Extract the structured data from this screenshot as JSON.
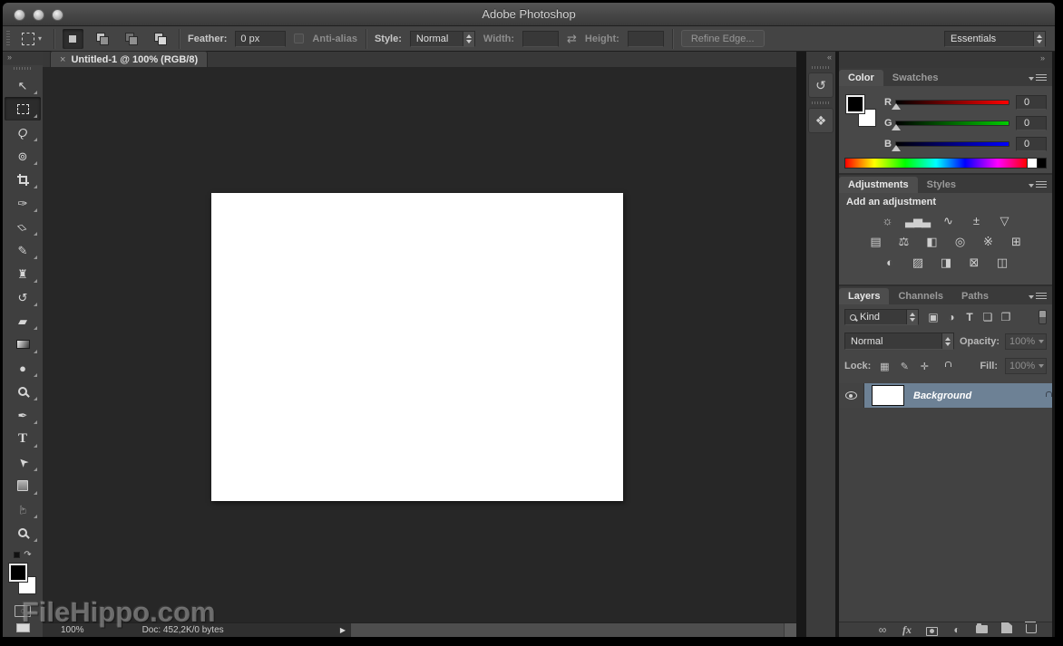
{
  "window": {
    "title": "Adobe Photoshop"
  },
  "options_bar": {
    "feather_label": "Feather:",
    "feather_value": "0 px",
    "antialias_label": "Anti-alias",
    "style_label": "Style:",
    "style_value": "Normal",
    "width_label": "Width:",
    "width_value": "",
    "height_label": "Height:",
    "height_value": "",
    "refine_edge_label": "Refine Edge...",
    "workspace_value": "Essentials"
  },
  "chrome": {
    "toolbar_collapse": "»",
    "dock_collapse": "«",
    "panels_collapse": "»",
    "swap_dims_icon": "⇄"
  },
  "document": {
    "tab_title": "Untitled-1 @ 100% (RGB/8)",
    "close_label": "×",
    "status": {
      "zoom": "100%",
      "doc_size": "Doc: 452,2K/0 bytes",
      "play_icon": "▶"
    }
  },
  "toolbar": {
    "tools": [
      {
        "name": "move-tool",
        "glyph": "↖"
      },
      {
        "name": "rectangular-marquee-tool",
        "glyph": "",
        "cls": "selected tool-marquee"
      },
      {
        "name": "lasso-tool",
        "glyph": "Q",
        "cls": "ital r15"
      },
      {
        "name": "quick-selection-tool",
        "glyph": "⊚"
      },
      {
        "name": "crop-tool",
        "glyph": "",
        "cls": "tool-crop"
      },
      {
        "name": "eyedropper-tool",
        "glyph": "✑"
      },
      {
        "name": "spot-healing-brush-tool",
        "glyph": "▱",
        "cls": "r45"
      },
      {
        "name": "brush-tool",
        "glyph": "✎"
      },
      {
        "name": "clone-stamp-tool",
        "glyph": "♜"
      },
      {
        "name": "history-brush-tool",
        "glyph": "↺"
      },
      {
        "name": "eraser-tool",
        "glyph": "▰"
      },
      {
        "name": "gradient-tool",
        "glyph": "",
        "cls": "tool-gradient"
      },
      {
        "name": "blur-tool",
        "glyph": "●"
      },
      {
        "name": "dodge-tool",
        "glyph": "",
        "cls": "tool-mag"
      },
      {
        "name": "pen-tool",
        "glyph": "✒"
      },
      {
        "name": "type-tool",
        "glyph": "T",
        "cls": "serif"
      },
      {
        "name": "path-selection-tool",
        "glyph": "➤",
        "cls": "rm135"
      },
      {
        "name": "rectangle-tool",
        "glyph": "",
        "cls": "tool-shape"
      },
      {
        "name": "hand-tool",
        "glyph": "☞",
        "cls": "rm90"
      },
      {
        "name": "zoom-tool",
        "glyph": "",
        "cls": "tool-mag"
      }
    ],
    "swap_colors_icon": "↷",
    "quick_mask_icon": "◌"
  },
  "panels": {
    "dock": {
      "icons": [
        {
          "name": "history-panel-icon",
          "glyph": "↺"
        },
        {
          "name": "properties-panel-icon",
          "glyph": "❖"
        }
      ]
    },
    "color": {
      "tabs": [
        "Color",
        "Swatches"
      ],
      "channels": [
        {
          "label": "R",
          "value": "0",
          "color": "#ff0000"
        },
        {
          "label": "G",
          "value": "0",
          "color": "#00cc00"
        },
        {
          "label": "B",
          "value": "0",
          "color": "#0000ff"
        }
      ]
    },
    "adjustments": {
      "tabs": [
        "Adjustments",
        "Styles"
      ],
      "hint": "Add an adjustment",
      "row1": [
        {
          "name": "brightness-contrast-icon",
          "glyph": "☼"
        },
        {
          "name": "levels-icon",
          "glyph": "▃▅▃"
        },
        {
          "name": "curves-icon",
          "glyph": "∿"
        },
        {
          "name": "exposure-icon",
          "glyph": "±"
        },
        {
          "name": "vibrance-icon",
          "glyph": "▽"
        }
      ],
      "row2": [
        {
          "name": "hue-saturation-icon",
          "glyph": "▤"
        },
        {
          "name": "color-balance-icon",
          "glyph": "⚖"
        },
        {
          "name": "black-white-icon",
          "glyph": "◧"
        },
        {
          "name": "photo-filter-icon",
          "glyph": "◎"
        },
        {
          "name": "channel-mixer-icon",
          "glyph": "※"
        },
        {
          "name": "color-lookup-icon",
          "glyph": "⊞"
        }
      ],
      "row3": [
        {
          "name": "invert-icon",
          "glyph": "◐"
        },
        {
          "name": "posterize-icon",
          "glyph": "▨"
        },
        {
          "name": "threshold-icon",
          "glyph": "◨"
        },
        {
          "name": "gradient-map-icon",
          "glyph": "⊠"
        },
        {
          "name": "selective-color-icon",
          "glyph": "◫"
        }
      ]
    },
    "layers": {
      "tabs": [
        "Layers",
        "Channels",
        "Paths"
      ],
      "filter_label": "Kind",
      "filter_icons": [
        {
          "name": "filter-pixel-layers-icon",
          "glyph": "▣"
        },
        {
          "name": "filter-adjustment-layers-icon",
          "glyph": "◑"
        },
        {
          "name": "filter-type-layers-icon",
          "glyph": "T",
          "cls": "bold"
        },
        {
          "name": "filter-shape-layers-icon",
          "glyph": "❏"
        },
        {
          "name": "filter-smart-objects-icon",
          "glyph": "❐"
        }
      ],
      "blend_mode": "Normal",
      "opacity_label": "Opacity:",
      "opacity_value": "100%",
      "lock_label": "Lock:",
      "lock_icons": [
        {
          "name": "lock-transparency-icon",
          "glyph": "▦"
        },
        {
          "name": "lock-pixels-icon",
          "glyph": "✎"
        },
        {
          "name": "lock-position-icon",
          "glyph": "✛"
        }
      ],
      "fill_label": "Fill:",
      "fill_value": "100%",
      "layer": {
        "name": "Background"
      },
      "bottom_icons": [
        {
          "name": "link-layers-icon",
          "glyph": "∞"
        },
        {
          "name": "layer-style-icon",
          "glyph": "fx",
          "cls": "fx-ico"
        },
        {
          "name": "layer-mask-icon",
          "glyph": "",
          "cls": "ico-mask"
        },
        {
          "name": "adjustment-layer-icon",
          "glyph": "◐"
        },
        {
          "name": "group-layers-icon",
          "glyph": "",
          "cls": "ico-folder"
        },
        {
          "name": "new-layer-icon",
          "glyph": "",
          "cls": "ico-newlayer"
        },
        {
          "name": "delete-layer-icon",
          "glyph": "",
          "cls": "ico-trash"
        }
      ]
    }
  },
  "watermark": {
    "text": "FileHippo.com"
  },
  "colors": {
    "selection_highlight": "#6d8195",
    "panel_bg": "#484848",
    "canvas_bg": "#272727",
    "red": "#ff0000",
    "green": "#00cc00",
    "blue": "#0000ff"
  }
}
